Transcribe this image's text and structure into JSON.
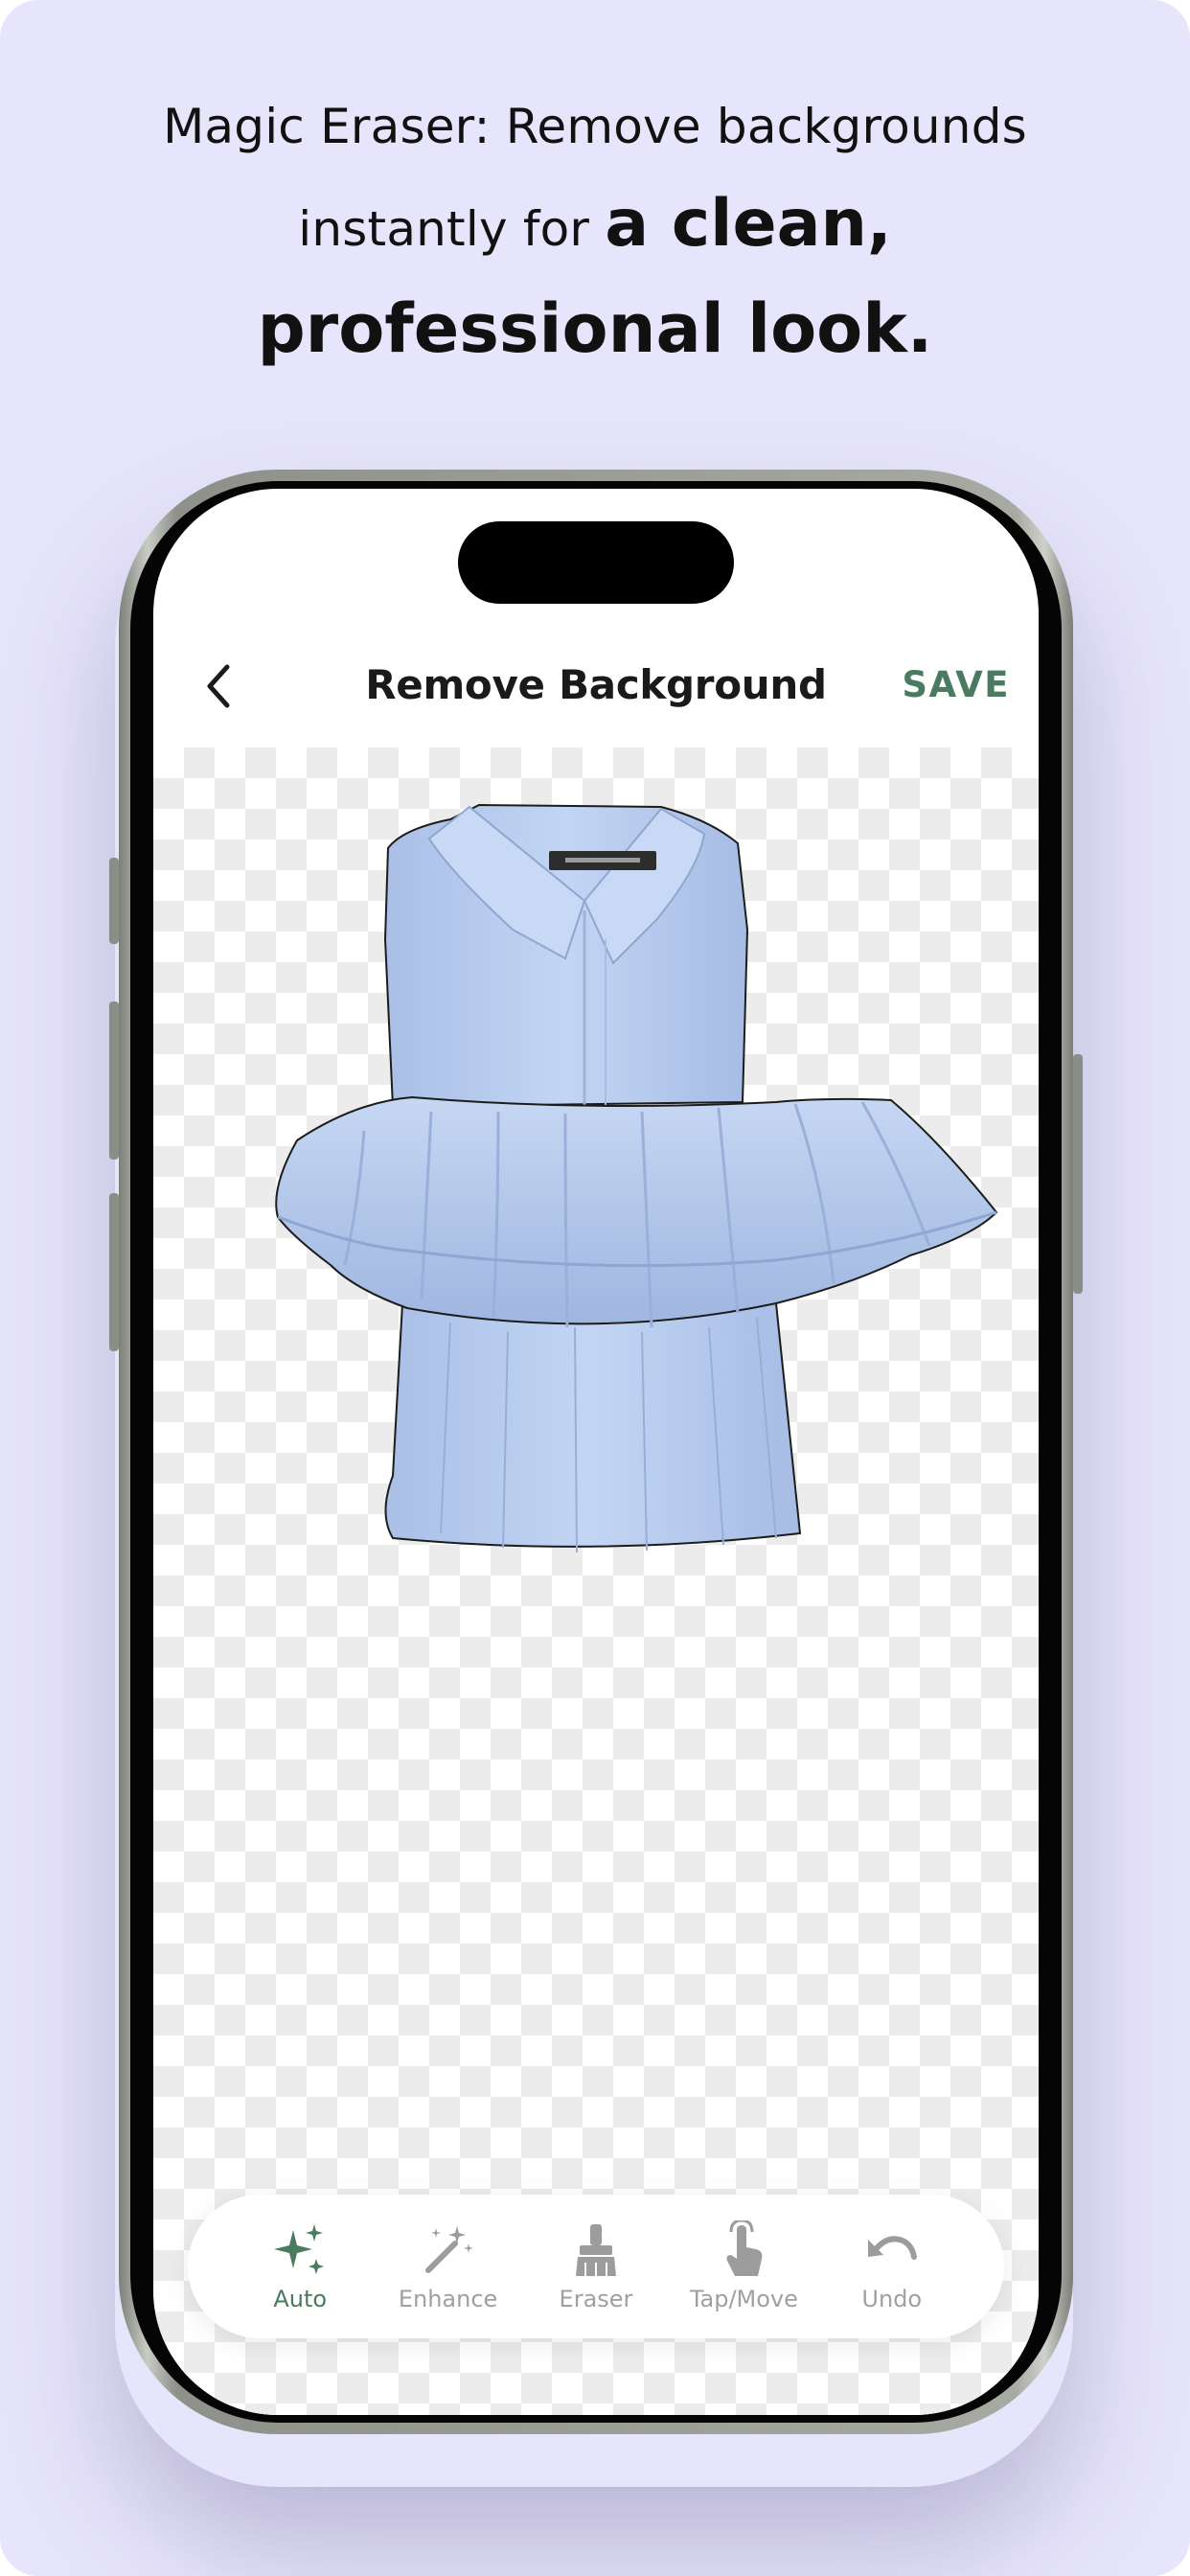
{
  "headline": {
    "line1": "Magic Eraser: Remove backgrounds",
    "line2_regular": "instantly for ",
    "line2_bold": "a clean,",
    "line3_bold": "professional look."
  },
  "nav": {
    "title": "Remove Background",
    "save_label": "SAVE",
    "back_icon": "chevron-left-icon"
  },
  "garment": {
    "description_icon": "blouse-image",
    "label_tag_color": "#2d2d2d"
  },
  "toolbar": {
    "tools": [
      {
        "label": "Auto",
        "icon": "sparkles-icon",
        "active": true
      },
      {
        "label": "Enhance",
        "icon": "magic-wand-icon",
        "active": false
      },
      {
        "label": "Eraser",
        "icon": "eraser-brush-icon",
        "active": false
      },
      {
        "label": "Tap/Move",
        "icon": "tap-hand-icon",
        "active": false
      },
      {
        "label": "Undo",
        "icon": "undo-icon",
        "active": false
      }
    ]
  },
  "colors": {
    "background": "#e7e5fb",
    "accent": "#4a7a60",
    "inactive": "#a0a0a0",
    "garment": "#b8cdf0"
  }
}
